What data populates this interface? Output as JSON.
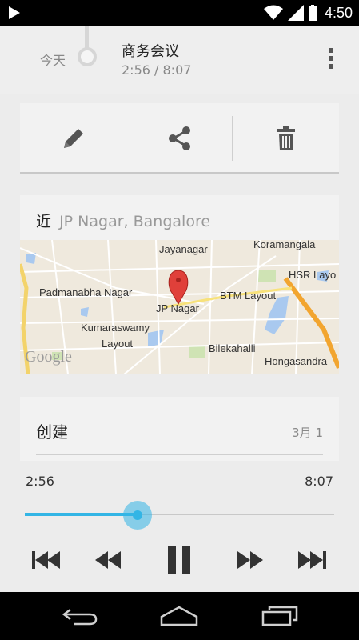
{
  "status_bar": {
    "time": "4:50",
    "icons": [
      "play-icon",
      "wifi-icon",
      "signal-icon",
      "battery-icon"
    ]
  },
  "header": {
    "day_label": "今天",
    "title": "商务会议",
    "duration": "2:56 / 8:07"
  },
  "actions": [
    {
      "icon": "pencil-icon"
    },
    {
      "icon": "share-icon"
    },
    {
      "icon": "trash-icon"
    }
  ],
  "location": {
    "prefix": "近",
    "place": "JP Nagar, Bangalore",
    "map_labels": {
      "jayanagar": "Jayanagar",
      "koramangala": "Koramangala",
      "padmanabha": "Padmanabha Nagar",
      "jpnagar": "JP Nagar",
      "btm": "BTM Layout",
      "hsr": "HSR Layo",
      "kumaraswamy1": "Kumaraswamy",
      "kumaraswamy2": "Layout",
      "bilekahalli": "Bilekahalli",
      "hongasandra": "Hongasandra",
      "google": "Google"
    }
  },
  "created": {
    "label": "创建",
    "date": "3月 1"
  },
  "player": {
    "current": "2:56",
    "total": "8:07",
    "progress": 0.3635
  },
  "nav": [
    "back-icon",
    "home-icon",
    "recents-icon"
  ],
  "colors": {
    "accent": "#33b5e5",
    "pin": "#e0403a"
  }
}
